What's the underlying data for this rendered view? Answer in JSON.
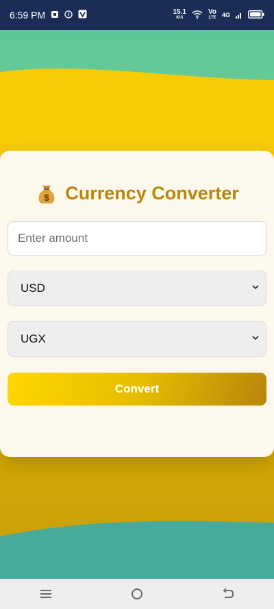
{
  "status_bar": {
    "time": "6:59 PM",
    "net_speed_value": "15.1",
    "net_speed_unit": "K/S",
    "volte_top": "Vo",
    "volte_bottom": "LTE",
    "network": "4G"
  },
  "app": {
    "title": "Currency Converter",
    "title_icon": "money-bag-icon",
    "amount_input": {
      "value": "",
      "placeholder": "Enter amount"
    },
    "from_currency": {
      "selected": "USD"
    },
    "to_currency": {
      "selected": "UGX"
    },
    "convert_label": "Convert"
  },
  "nav_bar": {
    "icons": [
      "menu-icon",
      "home-icon",
      "back-icon"
    ]
  },
  "colors": {
    "status_bar": "#1b2d57",
    "accent_gold": "#b8860b",
    "accent_yellow": "#ffd700",
    "teal_green": "#5fc796",
    "card_bg": "#fcf8ec"
  }
}
